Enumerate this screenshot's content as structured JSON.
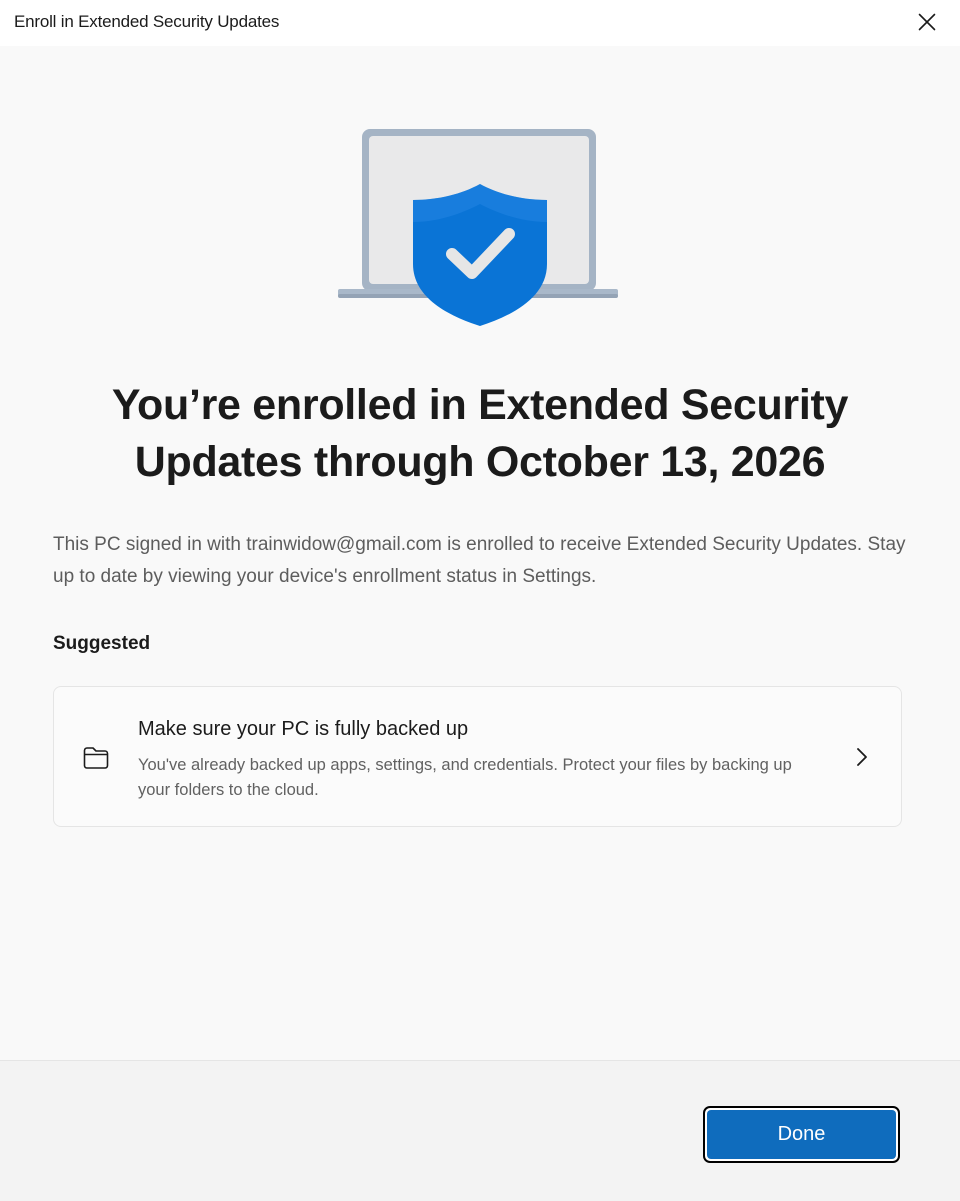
{
  "window": {
    "title": "Enroll in Extended Security Updates"
  },
  "icons": {
    "close": "close-icon",
    "hero": "laptop-shield-check-illustration",
    "card": "folder-icon",
    "card_arrow": "chevron-right-icon"
  },
  "hero": {
    "headline": "You’re enrolled in Extended Security Updates through October 13, 2026",
    "body": "This PC signed in with trainwidow@gmail.com is enrolled to receive Extended Security Updates. Stay up to date by viewing your device's enrollment status in Settings."
  },
  "suggested": {
    "heading": "Suggested",
    "card": {
      "title": "Make sure your PC is fully backed up",
      "description": "You've already backed up apps, settings, and credentials. Protect your files by backing up your folders to the cloud."
    }
  },
  "footer": {
    "done_label": "Done"
  },
  "colors": {
    "accent": "#0f6cbd",
    "shield": "#0a74d6",
    "background": "#f9f9f9",
    "footer": "#f3f3f3"
  }
}
